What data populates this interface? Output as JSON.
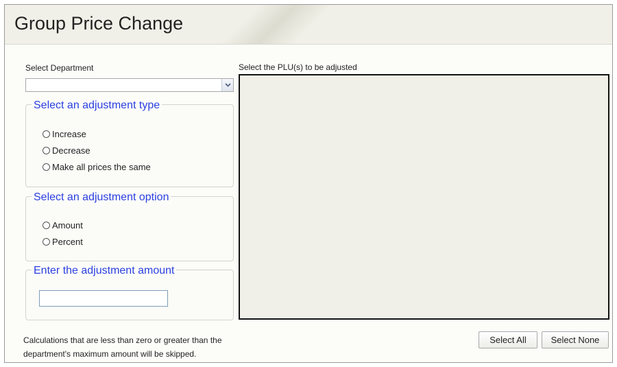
{
  "window": {
    "title": "Group Price Change"
  },
  "department": {
    "label": "Select Department",
    "value": ""
  },
  "adjustment_type": {
    "legend": "Select an adjustment type",
    "options": [
      "Increase",
      "Decrease",
      "Make all prices the same"
    ]
  },
  "adjustment_option": {
    "legend": "Select an adjustment option",
    "options": [
      "Amount",
      "Percent"
    ]
  },
  "adjustment_amount": {
    "legend": "Enter the adjustment amount",
    "value": ""
  },
  "plu": {
    "label": "Select the PLU(s) to be adjusted",
    "items": []
  },
  "footer": {
    "note_line1": "Calculations that are less than zero or greater than the",
    "note_line2": "department's maximum amount will be skipped.",
    "select_all_label": "Select All",
    "select_none_label": "Select None"
  },
  "colors": {
    "legend_text": "#2a3fe0",
    "panel_bg": "#f1f0e8"
  },
  "icons": {
    "dropdown": "chevron-down-icon"
  }
}
